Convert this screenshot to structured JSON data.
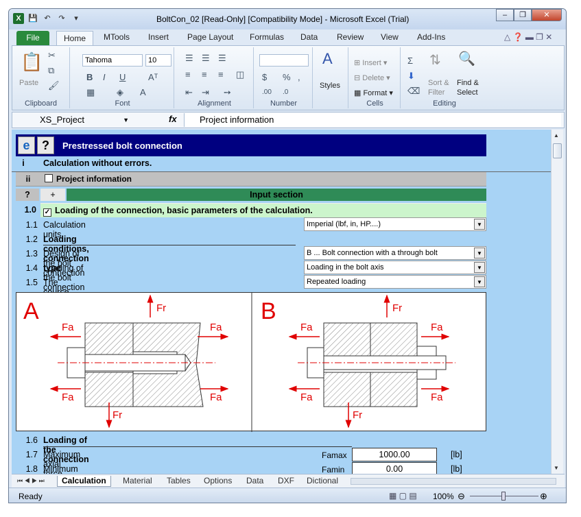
{
  "window": {
    "title": "BoltCon_02  [Read-Only]  [Compatibility Mode]  -  Microsoft Excel (Trial)"
  },
  "ribbon_tabs": [
    "File",
    "Home",
    "MTools",
    "Insert",
    "Page Layout",
    "Formulas",
    "Data",
    "Review",
    "View",
    "Add-Ins"
  ],
  "ribbon": {
    "font_name": "Tahoma",
    "font_size": "10",
    "groups": [
      "Clipboard",
      "Font",
      "Alignment",
      "Number",
      "Cells",
      "Editing"
    ],
    "paste": "Paste",
    "styles": "Styles",
    "insert": "Insert",
    "delete": "Delete",
    "format": "Format",
    "sort_filter": "Sort &\nFilter",
    "sort": "Sort &",
    "filter": "Filter",
    "find": "Find &",
    "select": "Select"
  },
  "formula_bar": {
    "name_box": "XS_Project",
    "fx": "fx",
    "content": "Project information"
  },
  "sheet": {
    "header_title": "Prestressed bolt connection",
    "row_i": {
      "num": "i",
      "text": "Calculation without errors."
    },
    "row_ii": {
      "num": "ii",
      "text": "Project information"
    },
    "row_q": {
      "num": "?",
      "plus": "+",
      "text": "Input section"
    },
    "row_10": {
      "num": "1.0",
      "text": "Loading of the connection, basic parameters of the calculation."
    },
    "rows": [
      {
        "num": "1.1",
        "label": "Calculation units",
        "value": "Imperial (lbf, in, HP....)"
      },
      {
        "num": "1.2",
        "label": "Loading conditions, connection type"
      },
      {
        "num": "1.3",
        "label": "Design of the bolt connection",
        "value": "B ... Bolt connection with a through bolt"
      },
      {
        "num": "1.4",
        "label": "Loading of the bolt connection",
        "value": "Loading in the bolt axis"
      },
      {
        "num": "1.5",
        "label": "The course of loading",
        "value": "Repeated loading"
      }
    ],
    "diagram": {
      "label_a": "A",
      "label_b": "B",
      "force_r": "Fr",
      "force_a": "Fa"
    },
    "row_16": {
      "num": "1.6",
      "label": "Loading of the connection"
    },
    "row_17": {
      "num": "1.7",
      "label": "Maximum axial force",
      "symbol": "Famax",
      "value": "1000.00",
      "unit": "[lb]"
    },
    "row_18": {
      "num": "1.8",
      "label": "Minimum axial force",
      "symbol": "Famin",
      "value": "0.00",
      "unit": "[lb]"
    }
  },
  "sheet_tabs": [
    "Calculation",
    "Material",
    "Tables",
    "Options",
    "Data",
    "DXF",
    "Dictional"
  ],
  "status": {
    "ready": "Ready",
    "zoom": "100%"
  },
  "colors": {
    "header_bar": "#000080",
    "sheet_bg": "#a8d3f5",
    "input_section": "#2f8b57",
    "section_row": "#ccf5cc",
    "drawing_red": "#e00000"
  }
}
